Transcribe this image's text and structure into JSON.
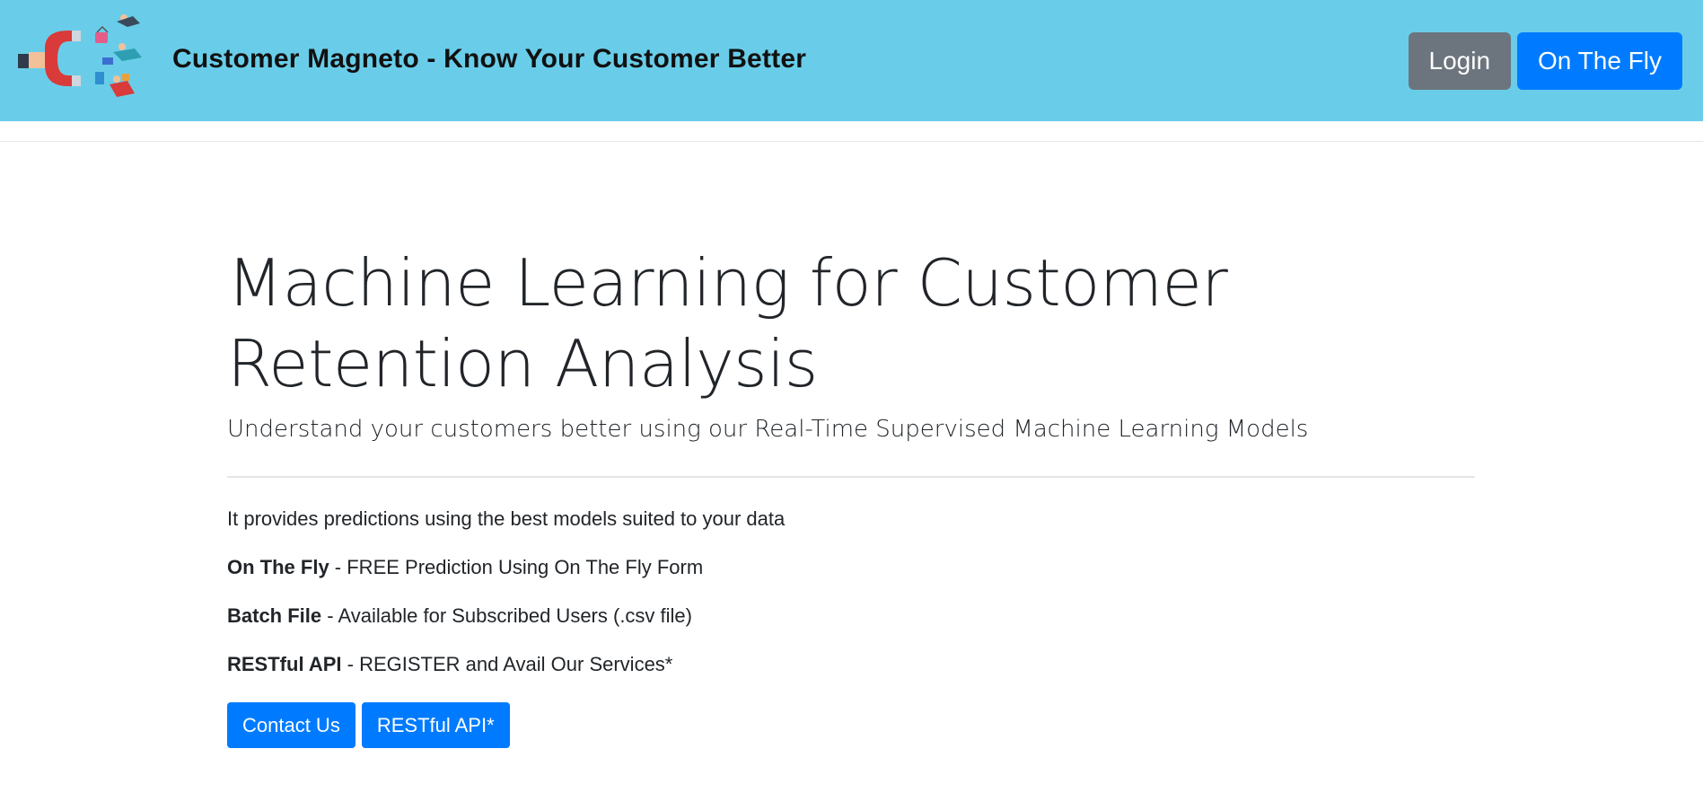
{
  "header": {
    "title": "Customer Magneto - Know Your Customer Better",
    "logo": "magnet-attracting-customers-icon",
    "background_color": "#69cde9",
    "buttons": {
      "login": "Login",
      "on_the_fly": "On The Fly"
    }
  },
  "hero": {
    "heading": "Machine Learning for Customer Retention Analysis",
    "lead": "Understand your customers better using our Real-Time Supervised Machine Learning Models",
    "intro": "It provides predictions using the best models suited to your data",
    "features": [
      {
        "label": "On The Fly",
        "text": " - FREE Prediction Using On The Fly Form"
      },
      {
        "label": "Batch File",
        "text": " - Available for Subscribed Users (.csv file)"
      },
      {
        "label": "RESTful API",
        "text": " - REGISTER and Avail Our Services*"
      }
    ],
    "buttons": {
      "contact": "Contact Us",
      "restful": "RESTful API*"
    }
  },
  "colors": {
    "primary": "#007bff",
    "secondary": "#6c757d"
  }
}
